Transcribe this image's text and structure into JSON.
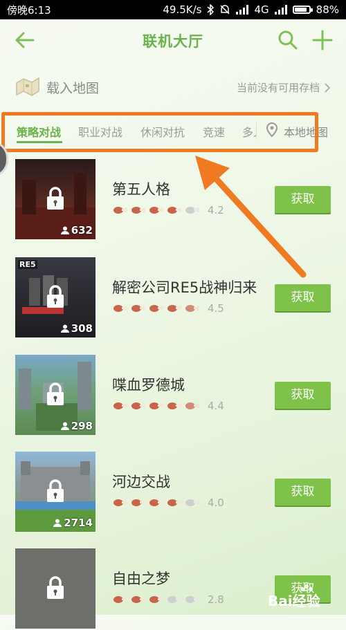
{
  "status_bar": {
    "time": "傍晚6:13",
    "speed": "49.5K/s",
    "network": "4G",
    "battery": "88%"
  },
  "header": {
    "title": "联机大厅",
    "back_icon": "back-arrow-icon",
    "search_icon": "search-icon",
    "add_icon": "plus-icon"
  },
  "load_map": {
    "label": "载入地图",
    "status": "当前没有可用存档"
  },
  "tabs": [
    {
      "label": "策略对战",
      "active": true
    },
    {
      "label": "职业对战",
      "active": false
    },
    {
      "label": "休闲对抗",
      "active": false
    },
    {
      "label": "竞速",
      "active": false
    },
    {
      "label": "多人",
      "active": false
    }
  ],
  "local_map_label": "本地地图",
  "maps": [
    {
      "name": "第五人格",
      "rating": "4.2",
      "players": "632",
      "button": "获取",
      "thumb_text": ""
    },
    {
      "name": "解密公司RE5战神归来",
      "rating": "4.5",
      "players": "308",
      "button": "获取",
      "thumb_text": "RE5"
    },
    {
      "name": "喋血罗德城",
      "rating": "4.4",
      "players": "298",
      "button": "获取",
      "thumb_text": ""
    },
    {
      "name": "河边交战",
      "rating": "4.0",
      "players": "2714",
      "button": "获取",
      "thumb_text": ""
    },
    {
      "name": "自由之梦",
      "rating": "2.8",
      "players": "",
      "button": "获取",
      "thumb_text": ""
    }
  ],
  "watermark": "Bai经验",
  "colors": {
    "accent": "#6ab34a",
    "button": "#7fc24a",
    "highlight": "#f07a22"
  }
}
